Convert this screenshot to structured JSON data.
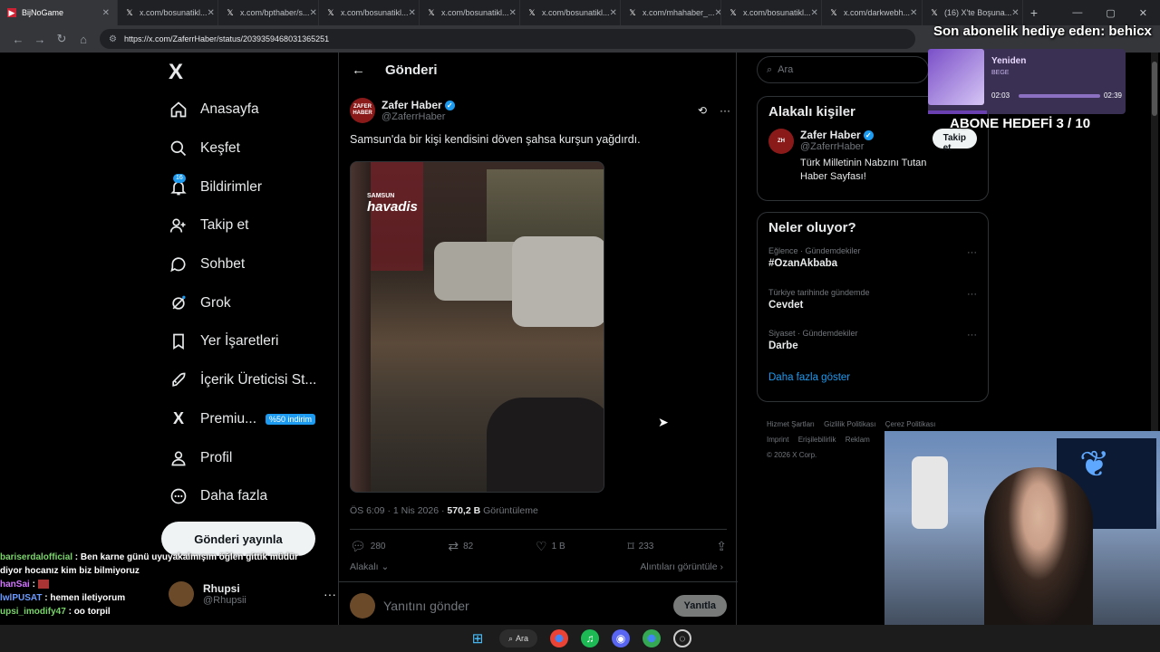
{
  "browser": {
    "tabs": [
      {
        "label": "BijNoGame",
        "active": true
      },
      {
        "label": "x.com/bosunatikl..."
      },
      {
        "label": "x.com/bpthaber/s..."
      },
      {
        "label": "x.com/bosunatikl..."
      },
      {
        "label": "x.com/bosunatikl..."
      },
      {
        "label": "x.com/bosunatikl..."
      },
      {
        "label": "x.com/mhahaber_..."
      },
      {
        "label": "x.com/bosunatikl..."
      },
      {
        "label": "x.com/darkwebh..."
      },
      {
        "label": "(16) X'te Boşuna..."
      }
    ],
    "url": "https://x.com/ZaferrHaber/status/2039359468031365251"
  },
  "stream_overlay": {
    "last_sub": "Son abonelik hediye eden: behicx",
    "goal": "ABONE HEDEFİ 3 / 10",
    "goal_fraction": 0.3,
    "music": {
      "song": "Yeniden",
      "artist": "BEGE",
      "elapsed": "02:03",
      "total": "02:39",
      "progress_fraction": 0.77
    }
  },
  "sidebar": {
    "logo": "X",
    "items": [
      {
        "label": "Anasayfa",
        "icon": "home-icon"
      },
      {
        "label": "Keşfet",
        "icon": "search-icon"
      },
      {
        "label": "Bildirimler",
        "icon": "bell-icon",
        "badge": "16"
      },
      {
        "label": "Takip et",
        "icon": "person-plus-icon"
      },
      {
        "label": "Sohbet",
        "icon": "chat-bubble-icon"
      },
      {
        "label": "Grok",
        "icon": "grok-icon"
      },
      {
        "label": "Yer İşaretleri",
        "icon": "bookmark-icon"
      },
      {
        "label": "İçerik Üreticisi St...",
        "icon": "rocket-icon"
      },
      {
        "label": "Premiu...",
        "icon": "x-logo-icon",
        "promo": "%50 indirim"
      },
      {
        "label": "Profil",
        "icon": "person-icon"
      },
      {
        "label": "Daha fazla",
        "icon": "more-circle-icon"
      }
    ],
    "post_button": "Gönderi yayınla",
    "account": {
      "name": "Rhupsi",
      "handle": "@Rhupsii"
    }
  },
  "main": {
    "header_title": "Gönderi",
    "author": {
      "name": "Zafer Haber",
      "handle": "@ZaferrHaber",
      "avatar_text": "ZAFER HABER"
    },
    "text": "Samsun'da bir kişi kendisini döven şahsa kurşun yağdırdı.",
    "media_logo_top": "SAMSUN",
    "media_logo_main": "havadis",
    "time": "ÖS 6:09 · 1 Nis 2026 · ",
    "views": "570,2 B",
    "views_label": " Görüntüleme",
    "actions": {
      "replies": "280",
      "reposts": "82",
      "likes": "1 B",
      "bookmarks": "233"
    },
    "relevance": "Alakalı",
    "quotes": "Alıntıları görüntüle",
    "reply_placeholder": "Yanıtını gönder",
    "reply_button": "Yanıtla"
  },
  "right": {
    "search_placeholder": "Ara",
    "related_title": "Alakalı kişiler",
    "related": {
      "name": "Zafer Haber",
      "handle": "@ZaferrHaber",
      "bio": "Türk Milletinin Nabzını Tutan Haber Sayfası!",
      "follow": "Takip et"
    },
    "trends_title": "Neler oluyor?",
    "trends": [
      {
        "context": "Eğlence · Gündemdekiler",
        "title": "#OzanAkbaba"
      },
      {
        "context": "Türkiye tarihinde gündemde",
        "title": "Cevdet"
      },
      {
        "context": "Siyaset · Gündemdekiler",
        "title": "Darbe"
      }
    ],
    "show_more": "Daha fazla göster",
    "footer": [
      "Hizmet Şartları",
      "Gizlilik Politikası",
      "Çerez Politikası",
      "Imprint",
      "Erişilebilirlik",
      "Reklam",
      "© 2026 X Corp."
    ]
  },
  "chat": [
    {
      "user": "bariserdalofficial",
      "message": "Ben karne günü uyuyakalmışım öğlen gittik müdür diyor hocanız kim biz bilmiyoruz"
    },
    {
      "user": "hanSai",
      "message": ""
    },
    {
      "user": "lwlPUSAT",
      "message": "hemen iletiyorum"
    },
    {
      "user": "upsi_imodify47",
      "message": "oo torpil"
    }
  ],
  "taskbar": {
    "search": "Ara"
  }
}
